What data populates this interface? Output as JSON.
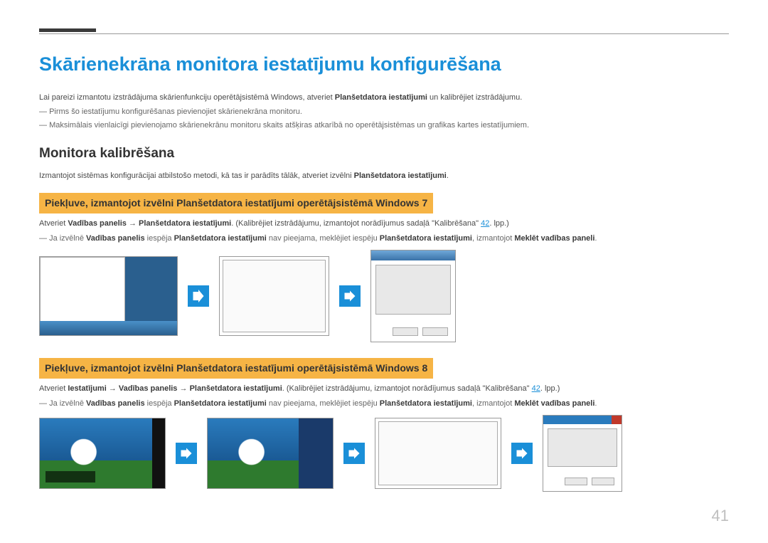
{
  "title": "Skārienekrāna monitora iestatījumu konfigurēšana",
  "intro": {
    "p1_prefix": "Lai pareizi izmantotu izstrādājuma skārienfunkciju operētājsistēmā Windows, atveriet ",
    "p1_bold": "Planšetdatora iestatījumi",
    "p1_suffix": " un kalibrējiet izstrādājumu.",
    "d1": "Pirms šo iestatījumu konfigurēšanas pievienojiet skārienekrāna monitoru.",
    "d2": "Maksimālais vienlaicīgi pievienojamo skārienekrānu monitoru skaits atšķiras atkarībā no operētājsistēmas un grafikas kartes iestatījumiem."
  },
  "section2": {
    "heading": "Monitora kalibrēšana",
    "p_prefix": "Izmantojot sistēmas konfigurācijai atbilstošo metodi, kā tas ir parādīts tālāk, atveriet izvēlni ",
    "p_bold": "Planšetdatora iestatījumi",
    "p_suffix": "."
  },
  "win7": {
    "band": "Piekļuve, izmantojot izvēlni Planšetdatora iestatījumi operētājsistēmā Windows 7",
    "p_prefix": "Atveriet ",
    "b1": "Vadības panelis",
    "arrow1": " → ",
    "b2": "Planšetdatora iestatījumi",
    "mid": ". (Kalibrējiet izstrādājumu, izmantojot norādījumus sadaļā \"Kalibrēšana\" ",
    "link": "42",
    "tail": ". lpp.)",
    "dash_prefix": "Ja izvēlnē ",
    "dash_b1": "Vadības panelis",
    "dash_mid1": " iespēja ",
    "dash_b2": "Planšetdatora iestatījumi",
    "dash_mid2": " nav pieejama, meklējiet iespēju ",
    "dash_b3": "Planšetdatora iestatījumi",
    "dash_mid3": ", izmantojot ",
    "dash_b4": "Meklēt vadības paneli",
    "dash_suffix": "."
  },
  "win8": {
    "band": "Piekļuve, izmantojot izvēlni Planšetdatora iestatījumi operētājsistēmā Windows 8",
    "p_prefix": "Atveriet ",
    "b1": "Iestatījumi",
    "arrow1": " → ",
    "b2": "Vadības panelis",
    "arrow2": " → ",
    "b3": "Planšetdatora iestatījumi",
    "mid": ". (Kalibrējiet izstrādājumu, izmantojot norādījumus sadaļā \"Kalibrēšana\" ",
    "link": "42",
    "tail": ". lpp.)",
    "dash_prefix": "Ja izvēlnē ",
    "dash_b1": "Vadības panelis",
    "dash_mid1": " iespēja ",
    "dash_b2": "Planšetdatora iestatījumi",
    "dash_mid2": " nav pieejama, meklējiet iespēju ",
    "dash_b3": "Planšetdatora iestatījumi",
    "dash_mid3": ", izmantojot ",
    "dash_b4": "Meklēt vadības paneli",
    "dash_suffix": "."
  },
  "page": "41"
}
